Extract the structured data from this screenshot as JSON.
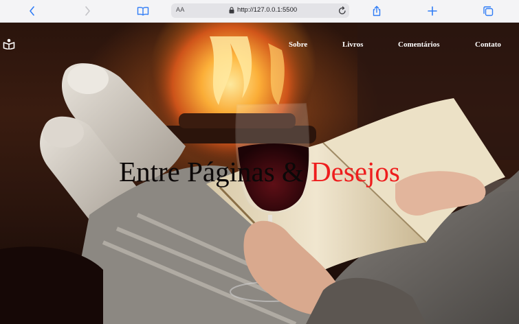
{
  "browser": {
    "text_size_label": "AA",
    "url": "http://127.0.0.1:5500",
    "icons": [
      "back-icon",
      "forward-icon",
      "reader-icon",
      "lock-icon",
      "reload-icon",
      "share-icon",
      "new-tab-icon",
      "tabs-icon"
    ]
  },
  "nav": {
    "items": [
      "Sobre",
      "Livros",
      "Comentários",
      "Contato"
    ]
  },
  "hero": {
    "title_part1": "Entre Páginas & ",
    "title_part2": "Desejos"
  },
  "colors": {
    "title_black": "#0c0808",
    "title_red": "#ee1d1d",
    "nav_text": "#ffffff",
    "chrome_accent": "#2f7cf6"
  }
}
